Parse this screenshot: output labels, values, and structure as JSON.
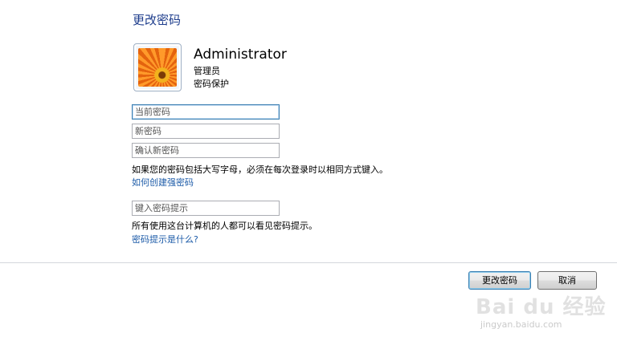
{
  "page": {
    "title": "更改密码"
  },
  "user": {
    "name": "Administrator",
    "role": "管理员",
    "status": "密码保护"
  },
  "fields": {
    "current_password_placeholder": "当前密码",
    "new_password_placeholder": "新密码",
    "confirm_password_placeholder": "确认新密码",
    "hint_placeholder": "键入密码提示"
  },
  "notes": {
    "case_note": "如果您的密码包括大写字母，必须在每次登录时以相同方式键入。",
    "hint_note": "所有使用这台计算机的人都可以看见密码提示。"
  },
  "links": {
    "strong_password": "如何创建强密码",
    "what_is_hint": "密码提示是什么?"
  },
  "buttons": {
    "change_password": "更改密码",
    "cancel": "取消"
  },
  "watermark": {
    "main": "Bai du 经验",
    "sub": "jingyan.baidu.com"
  },
  "colors": {
    "title": "#1e3d8c",
    "link": "#1c5ba8",
    "focus_border": "#3c7fb1"
  },
  "icons": {
    "avatar": "flower-avatar-icon"
  }
}
